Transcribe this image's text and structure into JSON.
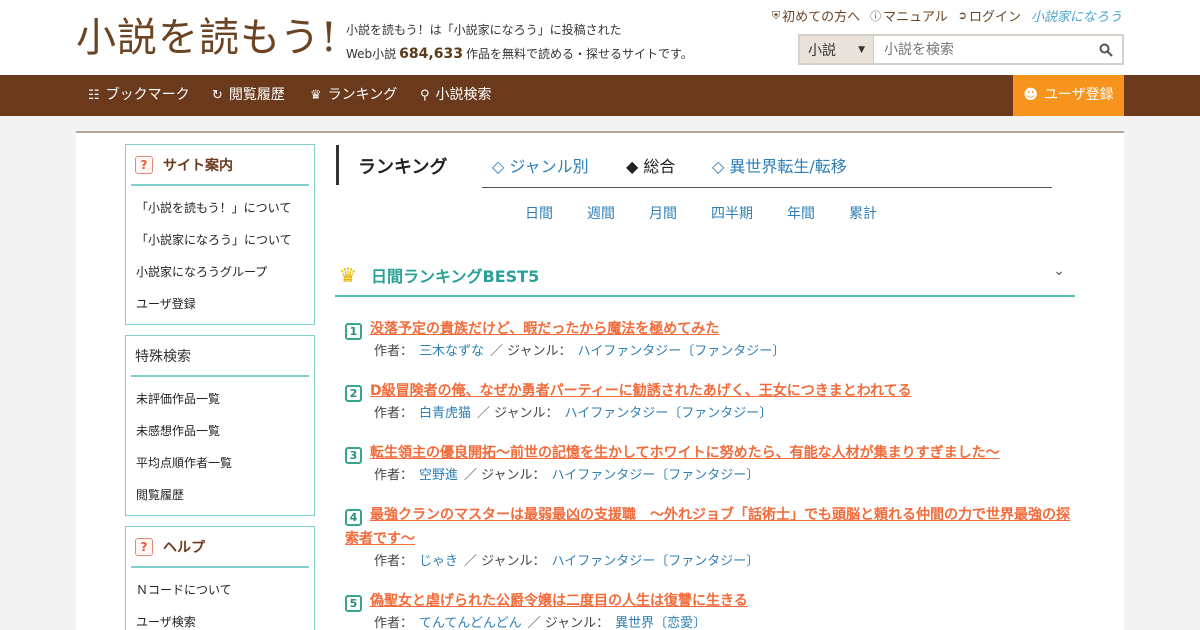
{
  "header": {
    "logo": "小説を読もう!",
    "tagline_line1": "小説を読もう！は「小説家になろう」に投稿された",
    "tagline_prefix": "Web小説",
    "tagline_count": "684,633",
    "tagline_suffix": "作品を無料で読める・探せるサイトです。",
    "links": {
      "beginner": "初めての方へ",
      "manual": "マニュアル",
      "login": "ログイン",
      "brand": "小説家になろう"
    },
    "search": {
      "category": "小説",
      "placeholder": "小説を検索"
    }
  },
  "nav": {
    "bookmark": "ブックマーク",
    "history": "閲覧履歴",
    "ranking": "ランキング",
    "search": "小説検索",
    "register": "ユーザ登録"
  },
  "sidebar": {
    "site_info": {
      "title": "サイト案内",
      "items": [
        "「小説を読もう！」について",
        "「小説家になろう」について",
        "小説家になろうグループ",
        "ユーザ登録"
      ]
    },
    "special_search": {
      "title": "特殊検索",
      "items": [
        "未評価作品一覧",
        "未感想作品一覧",
        "平均点順作者一覧",
        "閲覧履歴"
      ]
    },
    "help": {
      "title": "ヘルプ",
      "items": [
        "Ｎコードについて",
        "ユーザ検索"
      ]
    }
  },
  "ranking": {
    "heading": "ランキング",
    "tabs": [
      "◇ ジャンル別",
      "◆ 総合",
      "◇ 異世界転生/転移"
    ],
    "periods": [
      "日間",
      "週間",
      "月間",
      "四半期",
      "年間",
      "累計"
    ],
    "section_title": "日間ランキングBEST5",
    "author_label": "作者：",
    "genre_label": "ジャンル：",
    "entries": [
      {
        "rank": "1",
        "title": "没落予定の貴族だけど、暇だったから魔法を極めてみた",
        "author": "三木なずな",
        "genre": "ハイファンタジー〔ファンタジー〕"
      },
      {
        "rank": "2",
        "title": "D級冒険者の俺、なぜか勇者パーティーに勧誘されたあげく、王女につきまとわれてる",
        "author": "白青虎猫",
        "genre": "ハイファンタジー〔ファンタジー〕"
      },
      {
        "rank": "3",
        "title": "転生領主の優良開拓〜前世の記憶を生かしてホワイトに努めたら、有能な人材が集まりすぎました〜",
        "author": "空野進",
        "genre": "ハイファンタジー〔ファンタジー〕"
      },
      {
        "rank": "4",
        "title": "最強クランのマスターは最弱最凶の支援職　～外れジョブ「話術士」でも頭脳と頼れる仲間の力で世界最強の探索者です～",
        "author": "じゃき",
        "genre": "ハイファンタジー〔ファンタジー〕"
      },
      {
        "rank": "5",
        "title": "偽聖女と虐げられた公爵令嬢は二度目の人生は復讐に生きる",
        "author": "てんてんどんどん",
        "genre": "異世界〔恋愛〕"
      }
    ]
  },
  "colors": {
    "brand_brown": "#6b3a1c",
    "accent_orange": "#f7941d",
    "link_blue": "#2e7fb6",
    "title_orange": "#f26b3a",
    "teal": "#58b8b0"
  }
}
